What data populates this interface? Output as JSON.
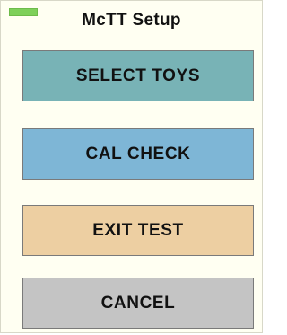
{
  "dialog": {
    "title": "McTT Setup",
    "status_indicator_color": "#7ed05a"
  },
  "buttons": [
    {
      "label": "SELECT TOYS",
      "color": "#78b3b6"
    },
    {
      "label": "CAL CHECK",
      "color": "#7eb6d6"
    },
    {
      "label": "EXIT TEST",
      "color": "#edcfa2"
    },
    {
      "label": "CANCEL",
      "color": "#c4c4c4"
    }
  ]
}
